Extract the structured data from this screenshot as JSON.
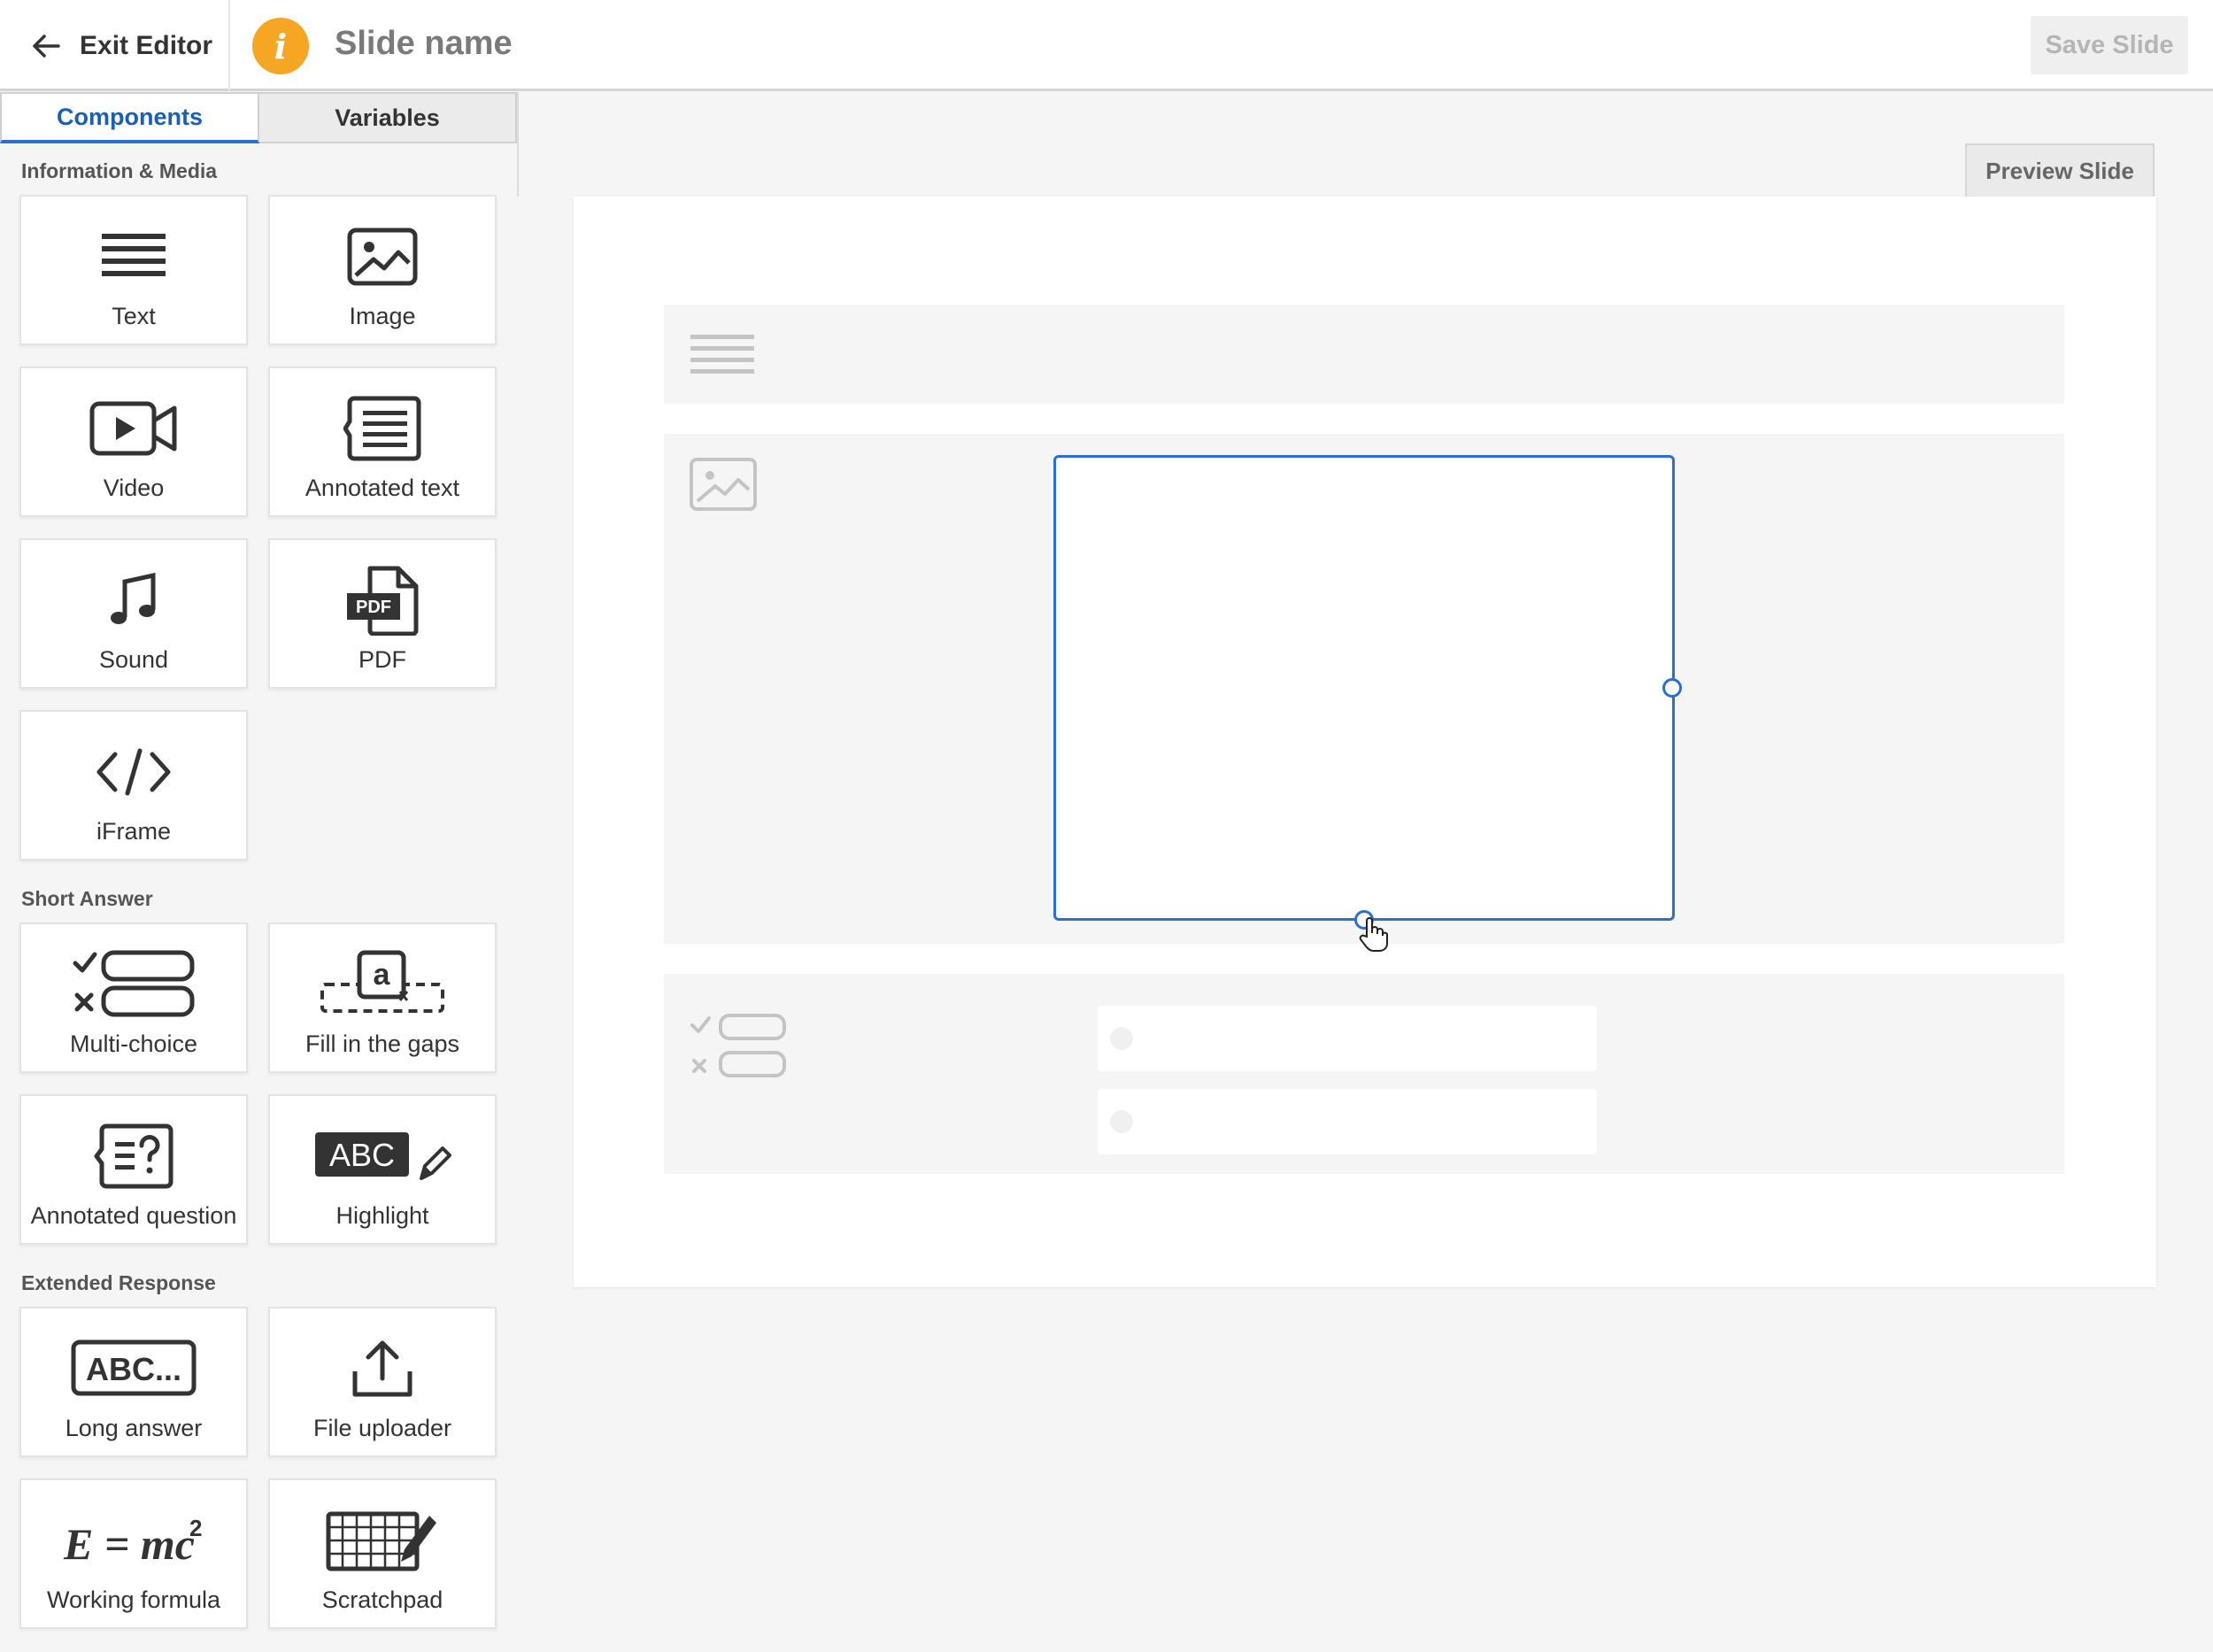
{
  "topbar": {
    "exit_label": "Exit Editor",
    "info_glyph": "i",
    "slide_name": "Slide name",
    "save_label": "Save Slide"
  },
  "tabs": [
    {
      "label": "Components",
      "active": true
    },
    {
      "label": "Variables",
      "active": false
    }
  ],
  "sections": {
    "info_media": "Information & Media",
    "short_answer": "Short Answer",
    "extended_response": "Extended Response"
  },
  "components": {
    "text": "Text",
    "image": "Image",
    "video": "Video",
    "annotated_text": "Annotated text",
    "sound": "Sound",
    "pdf": "PDF",
    "iframe": "iFrame",
    "multi_choice": "Multi-choice",
    "fill_gaps": "Fill in the gaps",
    "annotated_question": "Annotated question",
    "highlight": "Highlight",
    "long_answer": "Long answer",
    "file_uploader": "File uploader",
    "working_formula": "Working formula",
    "scratchpad": "Scratchpad"
  },
  "icon_text": {
    "pdf": "PDF",
    "fill_gaps": "a",
    "highlight": "ABC",
    "long_answer": "ABC...",
    "formula": "E = mc",
    "formula_sup": "2"
  },
  "canvas": {
    "preview_label": "Preview Slide"
  },
  "colors": {
    "accent": "#2b6fd1",
    "info_badge": "#f5a623"
  }
}
